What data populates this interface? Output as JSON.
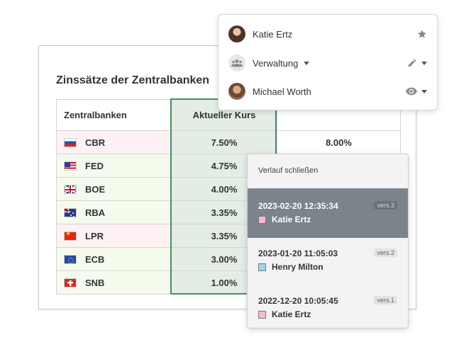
{
  "sheet": {
    "title": "Zinssätze der Zentralbanken",
    "columns": {
      "name": "Zentralbanken",
      "rate": "Aktueller Kurs",
      "extra": ""
    },
    "rows": [
      {
        "flag": "russia-flag-icon",
        "code": "CBR",
        "rate": "7.50%",
        "extra": "8.00%",
        "tint": "pink"
      },
      {
        "flag": "usa-flag-icon",
        "code": "FED",
        "rate": "4.75%",
        "extra": "",
        "tint": "green"
      },
      {
        "flag": "uk-flag-icon",
        "code": "BOE",
        "rate": "4.00%",
        "extra": "",
        "tint": "green"
      },
      {
        "flag": "australia-flag-icon",
        "code": "RBA",
        "rate": "3.35%",
        "extra": "",
        "tint": "green"
      },
      {
        "flag": "china-flag-icon",
        "code": "LPR",
        "rate": "3.35%",
        "extra": "",
        "tint": "pink"
      },
      {
        "flag": "eu-flag-icon",
        "code": "ECB",
        "rate": "3.00%",
        "extra": "",
        "tint": "green"
      },
      {
        "flag": "switzerland-flag-icon",
        "code": "SNB",
        "rate": "1.00%",
        "extra": "",
        "tint": "green"
      }
    ]
  },
  "collaborators": {
    "items": [
      {
        "name": "Katie Ertz",
        "avatar": "avatar-photo",
        "permission_icon": "star-icon",
        "has_caret": false,
        "name_caret": false
      },
      {
        "name": "Verwaltung",
        "avatar": "group-icon",
        "permission_icon": "pencil-icon",
        "has_caret": true,
        "name_caret": true
      },
      {
        "name": "Michael Worth",
        "avatar": "avatar-photo",
        "permission_icon": "eye-icon",
        "has_caret": true,
        "name_caret": false
      }
    ]
  },
  "history": {
    "close_label": "Verlauf schließen",
    "items": [
      {
        "datetime": "2023-02-20 12:35:34",
        "version": "vers.3",
        "user": "Katie Ertz",
        "color": "#f8b8d0",
        "active": true
      },
      {
        "datetime": "2023-01-20 11:05:03",
        "version": "vers.2",
        "user": "Henry Milton",
        "color": "#9fd3f0",
        "active": false
      },
      {
        "datetime": "2022-12-20 10:05:45",
        "version": "vers.1",
        "user": "Katie Ertz",
        "color": "#f8b8d0",
        "active": false
      }
    ]
  },
  "colors": {
    "accent_column_border": "#4d8a66",
    "active_history": "#7b848b"
  }
}
